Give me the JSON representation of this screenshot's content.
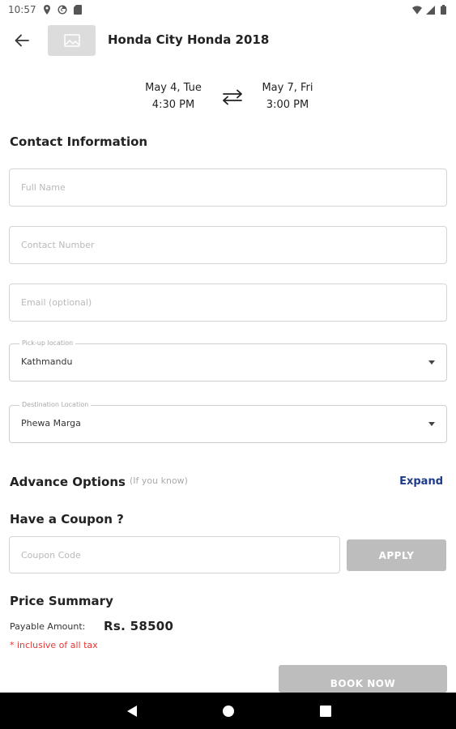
{
  "status_bar": {
    "time": "10:57"
  },
  "header": {
    "car_title": "Honda City Honda 2018"
  },
  "dates": {
    "start_date": "May 4, Tue",
    "start_time": "4:30 PM",
    "end_date": "May 7, Fri",
    "end_time": "3:00 PM"
  },
  "contact": {
    "section_title": "Contact Information",
    "full_name_placeholder": "Full Name",
    "contact_number_placeholder": "Contact Number",
    "email_placeholder": "Email (optional)",
    "pickup_label": "Pick-up location",
    "pickup_value": "Kathmandu",
    "destination_label": "Destination Location",
    "destination_value": "Phewa Marga"
  },
  "advance": {
    "title": "Advance Options",
    "hint": "(If you know)",
    "expand_label": "Expand"
  },
  "coupon": {
    "title": "Have a Coupon ?",
    "placeholder": "Coupon Code",
    "apply_label": "APPLY"
  },
  "price": {
    "title": "Price Summary",
    "payable_label": "Payable Amount:",
    "payable_amount": "Rs. 58500",
    "tax_note": "* inclusive of all tax",
    "book_label": "BOOK NOW"
  },
  "colors": {
    "link": "#1e3a8a",
    "disabled_button": "#bdbdbd",
    "tax_note": "#e53935"
  }
}
